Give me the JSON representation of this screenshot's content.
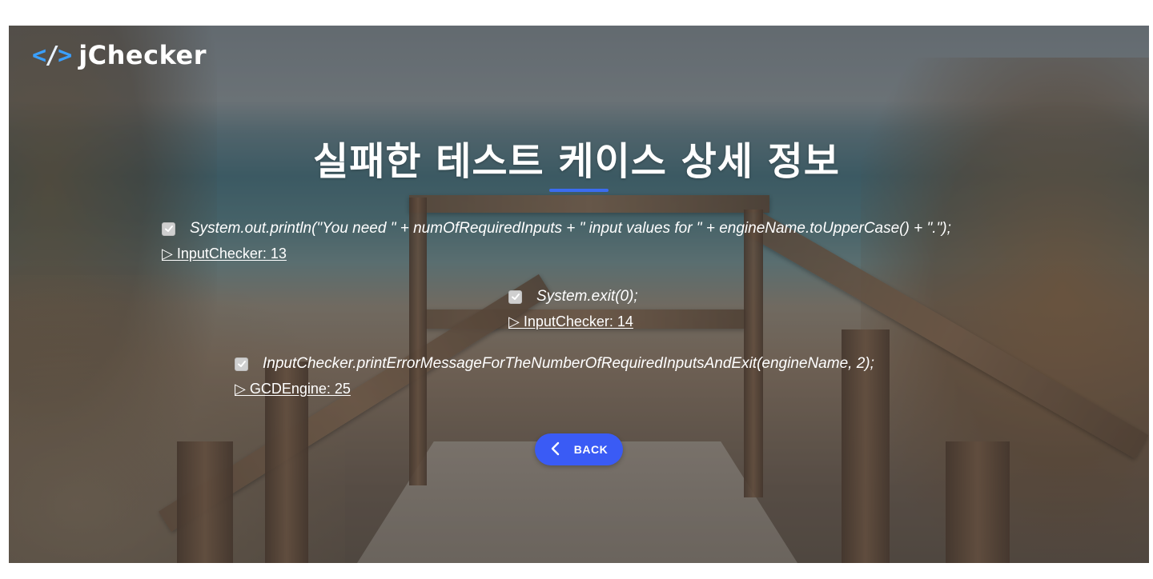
{
  "brand": {
    "logo_mark": {
      "left": "<",
      "slash": "/",
      "right": ">"
    },
    "name": "jChecker",
    "accent_color": "#3aa0ff"
  },
  "page": {
    "title": "실패한 테스트 케이스 상세 정보",
    "underline_color": "#3b6cf0"
  },
  "failed_cases": [
    {
      "code": "System.out.println(\"You need \" + numOfRequiredInputs + \" input values for \" + engineName.toUpperCase() + \".\");",
      "location": "▷ InputChecker: 13"
    },
    {
      "code": "System.exit(0);",
      "location": "▷ InputChecker: 14"
    },
    {
      "code": "InputChecker.printErrorMessageForTheNumberOfRequiredInputsAndExit(engineName, 2);",
      "location": "▷ GCDEngine: 25"
    }
  ],
  "back_button": {
    "label": "BACK",
    "icon": "chevron-left-icon",
    "color": "#3a5bf5"
  },
  "icons": {
    "checkbox": "checkmark-icon"
  }
}
